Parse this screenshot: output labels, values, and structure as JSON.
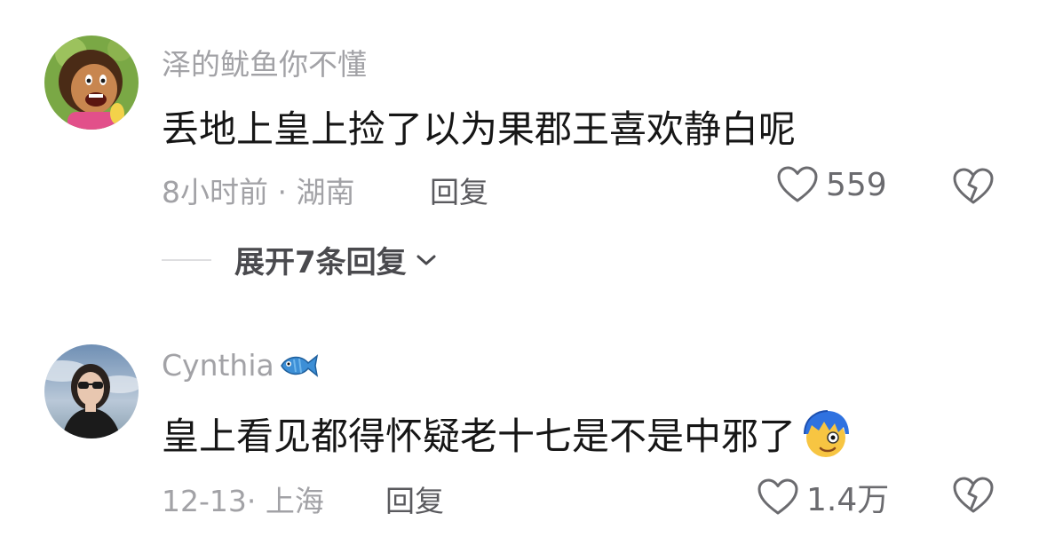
{
  "comments": [
    {
      "username": "泽的鱿鱼你不懂",
      "text": "丢地上皇上捡了以为果郡王喜欢静白呢",
      "meta": "8小时前 · 湖南",
      "reply_label": "回复",
      "like_count": "559",
      "avatar_icon": "cartoon-girl-avatar",
      "expand_label": "展开7条回复"
    },
    {
      "username": "Cynthia",
      "username_emoji": "fish-emoji-icon",
      "text": "皇上看见都得怀疑老十七是不是中邪了",
      "text_emoji": "blue-hair-face-emoji-icon",
      "meta": "12-13· 上海",
      "reply_label": "回复",
      "like_count": "1.4万",
      "avatar_icon": "woman-photo-avatar"
    }
  ],
  "colors": {
    "secondary_text": "#a2a2a6",
    "primary_text": "#161616",
    "reply_text": "#5a5a5e"
  }
}
